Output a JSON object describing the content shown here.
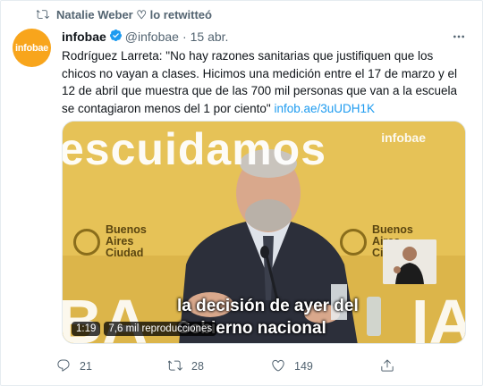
{
  "retweet_line": "Natalie Weber ♡ lo retwitteó",
  "author": {
    "avatar_text": "infobae",
    "name": "infobae",
    "handle": "@infobae",
    "separator": "·",
    "date": "15 abr."
  },
  "tweet": {
    "text": "Rodríguez Larreta: \"No hay razones sanitarias que justifiquen que los chicos no vayan a clases. Hicimos una medición entre el 17 de marzo y el 12 de abril que muestra que de las 700 mil personas que van a la escuela se contagiaron menos del 1 por ciento\"",
    "link": "infob.ae/3uUDH1K"
  },
  "video": {
    "background_word": "escuidamos",
    "watermark": "infobae",
    "logo_left": [
      "Buenos",
      "Aires",
      "Ciudad"
    ],
    "logo_right": [
      "Buenos",
      "Aires",
      "Ciudad"
    ],
    "subtitle_line1": "la decisión de ayer del",
    "subtitle_line2": "Gobierno nacional",
    "duration": "1:19",
    "views": "7,6 mil reproducciones"
  },
  "actions": {
    "reply_count": "21",
    "retweet_count": "28",
    "like_count": "149"
  },
  "colors": {
    "accent": "#1d9bf0",
    "avatar_bg": "#f8a51c",
    "video_bg": "#e8c45a",
    "muted": "#536471"
  },
  "icons": {
    "retweet": "retweet-icon",
    "verified": "verified-badge-icon",
    "more": "more-icon",
    "reply": "reply-icon",
    "like": "heart-icon",
    "share": "share-icon"
  }
}
